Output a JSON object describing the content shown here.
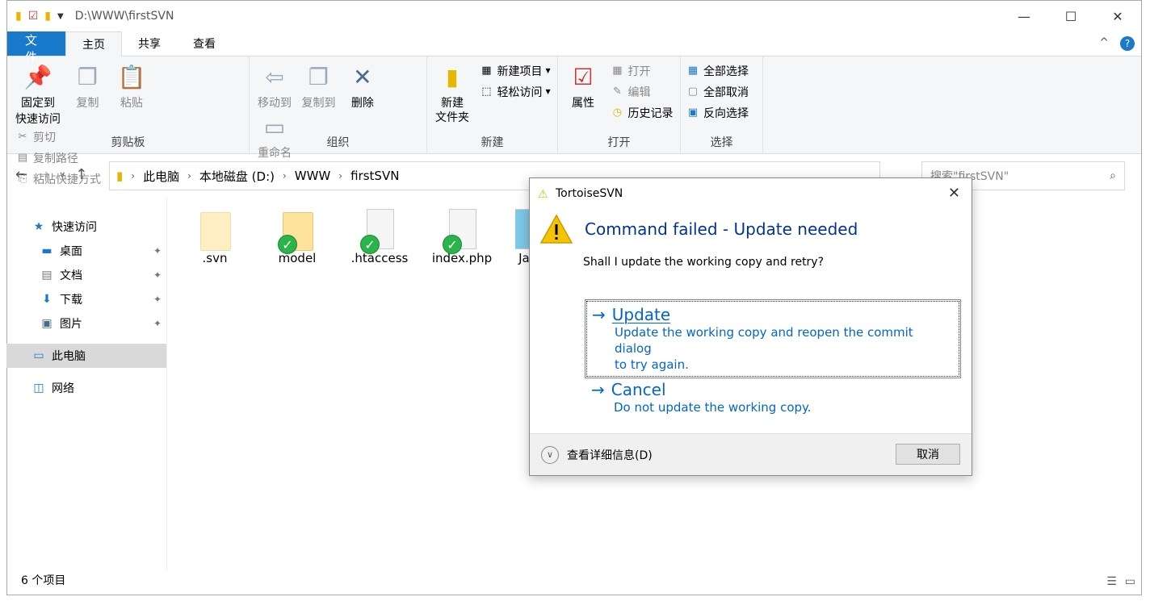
{
  "window": {
    "path_title": "D:\\WWW\\firstSVN",
    "controls": {
      "minimize": "—",
      "maximize": "☐",
      "close": "✕"
    }
  },
  "tabs": [
    {
      "label": "文件"
    },
    {
      "label": "主页"
    },
    {
      "label": "共享"
    },
    {
      "label": "查看"
    }
  ],
  "ribbon": {
    "clipboard": {
      "group_label": "剪贴板",
      "pin_line1": "固定到",
      "pin_line2": "快速访问",
      "copy": "复制",
      "paste": "粘贴",
      "cut": "剪切",
      "copy_path": "复制路径",
      "paste_shortcut": "粘贴快捷方式"
    },
    "organize": {
      "group_label": "组织",
      "move_to": "移动到",
      "copy_to": "复制到",
      "delete": "删除",
      "rename": "重命名"
    },
    "new": {
      "group_label": "新建",
      "new_folder_line1": "新建",
      "new_folder_line2": "文件夹",
      "new_item": "新建项目",
      "easy_access": "轻松访问"
    },
    "open": {
      "group_label": "打开",
      "properties": "属性",
      "open": "打开",
      "edit": "编辑",
      "history": "历史记录"
    },
    "select": {
      "group_label": "选择",
      "select_all": "全部选择",
      "select_none": "全部取消",
      "invert": "反向选择"
    }
  },
  "address": {
    "crumbs": [
      "此电脑",
      "本地磁盘 (D:)",
      "WWW",
      "firstSVN"
    ],
    "search_placeholder": "搜索\"firstSVN\""
  },
  "nav": [
    {
      "label": "快速访问",
      "icon": "star-icon",
      "pinned": false
    },
    {
      "label": "桌面",
      "icon": "desktop-icon",
      "pinned": true
    },
    {
      "label": "文档",
      "icon": "documents-icon",
      "pinned": true
    },
    {
      "label": "下载",
      "icon": "download-icon",
      "pinned": true
    },
    {
      "label": "图片",
      "icon": "pictures-icon",
      "pinned": true
    },
    {
      "label": "此电脑",
      "icon": "computer-icon",
      "pinned": false
    },
    {
      "label": "网络",
      "icon": "network-icon",
      "pinned": false
    }
  ],
  "files": [
    {
      "name": ".svn",
      "kind": "folder",
      "svn_ok": false
    },
    {
      "name": "model",
      "kind": "folder",
      "svn_ok": true
    },
    {
      "name": ".htaccess",
      "kind": "doc",
      "svn_ok": true
    },
    {
      "name": "index.php",
      "kind": "doc",
      "svn_ok": true
    },
    {
      "name": "Jac",
      "kind": "doc",
      "svn_ok": false
    }
  ],
  "status": {
    "count": "6 个项目"
  },
  "dialog": {
    "title": "TortoiseSVN",
    "instruction": "Command failed - Update needed",
    "content": "Shall I update the working copy and retry?",
    "update_title": "Update",
    "update_desc1": "Update the working copy and reopen the commit dialog",
    "update_desc2": "to try again.",
    "cancel_title": "Cancel",
    "cancel_desc": "Do not update the working copy.",
    "details": "查看详细信息(D)",
    "cancel_button": "取消"
  },
  "colors": {
    "accent": "#1979ca",
    "instruction": "#003399",
    "command_link": "#0066cc",
    "svn_ok": "#2bb44a"
  }
}
